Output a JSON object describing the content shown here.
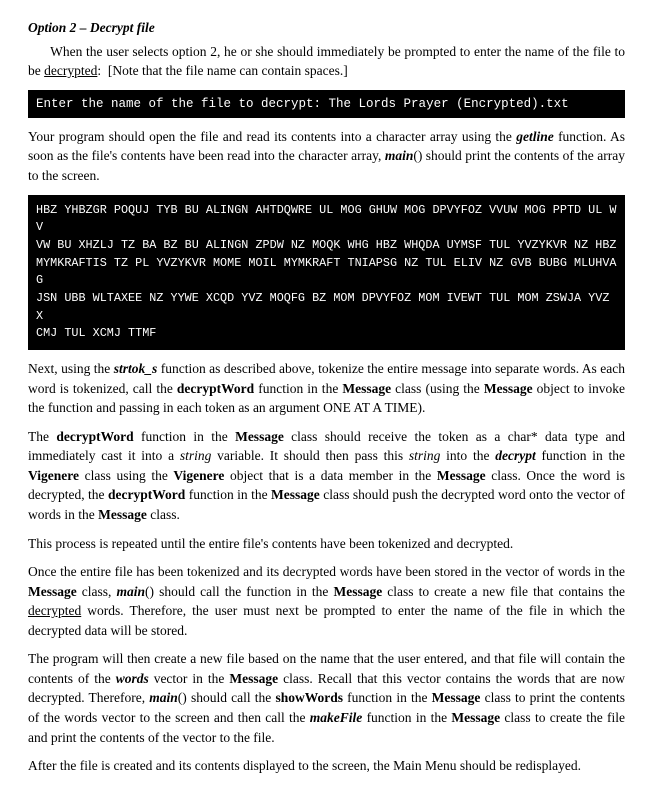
{
  "title": {
    "label": "Option 2 – Decrypt file"
  },
  "intro_text": "When the user selects option 2, he or she should immediately be prompted to enter the name of the file to be decrypted:  [Note that the file name can contain spaces.]",
  "prompt_bar": "Enter the name of the file to decrypt:   The Lords Prayer (Encrypted).txt",
  "para1": "Your program should open the file and read its contents into a character array using the getline function. As soon as the file's contents have been read into the character array, main() should print the contents of the array to the screen.",
  "code_block": "HBZ YHBZGR POQUJ TYB BU ALINGN AHTDQWRE UL MOG GHUW MOG DPVYFOZ VVUW MOG PPTD UL WV\nVW BU XHZLJ TZ BA BZ BU ALINGN ZPDW NZ MOQK WHG HBZ WHQDA UYMSF TUL YVZYKVR NZ HBZ\nMYMKRAFTIS TZ PL YVZYKVR MOME MOIL MYMKRAFT TNIAPSG NZ TUL ELIV NZ GVB BUBG MLUHVAG\nJSN UBB WLTAXEE NZ YYWE XCQD YVZ MOQFG BZ MOM DPVYFOZ MOM IVEWT TUL MOM ZSWJA YVZ X\nCMJ TUL XCMJ TTMF",
  "para2": "Next, using the strtok_s function as described above, tokenize the entire message into separate words.  As each word is tokenized, call the decryptWord function in the Message class (using the Message object to invoke the function and passing in each token as an argument ONE AT A TIME).",
  "para3": "The decryptWord function in the Message class should receive the token as a char* data type and immediately cast it into a string variable. It should then pass this string into the decrypt function in the Vigenere class using the Vigenere object that is a data member in the Message class.  Once the word is decrypted, the decryptWord function in the Message class should push the decrypted word onto the vector of words in the Message class.",
  "para4": "This process is repeated until the entire file's contents have been tokenized and decrypted.",
  "para5": "Once the entire file has been tokenized and its decrypted words have been stored in the vector of words in the Message class, main() should call the function in the Message class to create a new file that contains the decrypted words.  Therefore, the user must next be prompted to enter the name of the file in which the decrypted data will be stored.",
  "para6": "The program will then create a new file based on the name that the user entered, and that file will contain the contents of the words vector in the Message class.  Recall that this vector contains the words that are now decrypted.  Therefore, main() should call the showWords function in the Message class to print the contents of the words vector to the screen and then call the makeFile function in the Message class to create the file and print the contents of the vector to the file.",
  "para7": "After the file is created and its contents displayed to the screen, the Main Menu should be redisplayed.",
  "labels": {
    "option": "option",
    "getline": "getline",
    "main": "main",
    "strtok_s": "strtok_s",
    "decryptWord": "decryptWord",
    "Message": "Message",
    "decrypt": "decrypt",
    "Vigenere": "Vigenere",
    "words": "words",
    "showWords": "showWords",
    "makeFile": "makeFile"
  }
}
